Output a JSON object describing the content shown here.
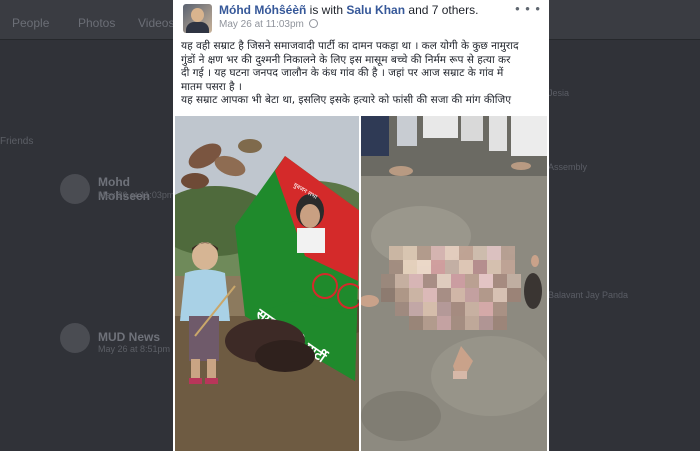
{
  "background": {
    "tabs": [
      "People",
      "Photos",
      "Videos"
    ],
    "left_label": "Friends",
    "posts": [
      {
        "name": "Mohd Mohseen",
        "sub": "May 26 at 11:03pm"
      },
      {
        "name": "MUD News",
        "sub": "May 26 at 8:51pm"
      }
    ],
    "sidebar": [
      "Jesia",
      "Assembly",
      "Balavant Jay Panda"
    ]
  },
  "post": {
    "author": "Móhd Móhŝéèñ",
    "is_with": "is with",
    "with_name": "Salu Khan",
    "and_others": "and 7 others.",
    "date": "May 26 at 11:03pm",
    "more_label": "• • •",
    "text_lines": [
      "यह वही सम्राट है जिसने समाजवादी पार्टी का दामन पकड़ा था । कल योगी के कुछ नामुराद",
      "गुंडों ने क्षण भर की दुश्मनी निकालने के लिए इस मासूम बच्चे की निर्मम रूप से हत्या कर",
      "दी गई । यह घटना जनपद जालौन के कंध गांव की है । जहां पर आज सम्राट के गांव में",
      "मातम पसरा है ।",
      "यह सम्राट आपका भी बेटा था, इसलिए इसके हत्यारे को फांसी की सजा की मांग कीजिए"
    ],
    "flag_text": "समाजवादी पार्टी",
    "flag_small": "युवजन सभा"
  },
  "colors": {
    "link": "#365899",
    "flag_red": "#d42a2a",
    "flag_green": "#1f8a2c"
  }
}
